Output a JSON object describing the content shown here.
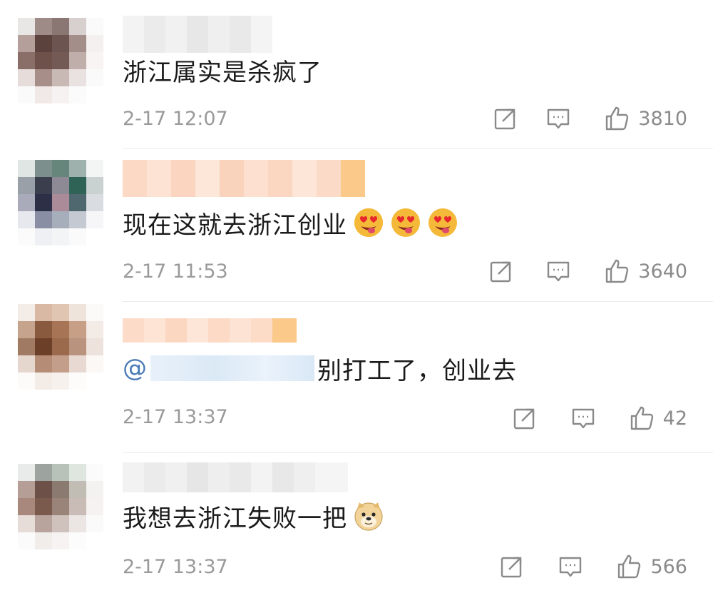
{
  "comments": [
    {
      "text": "浙江属实是杀疯了",
      "time": "2-17 12:07",
      "likes": "3810",
      "emojis": []
    },
    {
      "text": "现在这就去浙江创业",
      "time": "2-17 11:53",
      "likes": "3640",
      "emojis": [
        "heart-eyes-emoji",
        "heart-eyes-emoji",
        "heart-eyes-emoji"
      ]
    },
    {
      "mention": "@",
      "text": "别打工了，创业去",
      "time": "2-17 13:37",
      "likes": "42",
      "emojis": []
    },
    {
      "text": "我想去浙江失败一把",
      "time": "2-17 13:37",
      "likes": "566",
      "emojis": [
        "doge-emoji"
      ]
    }
  ],
  "icons": {
    "share": "share-icon",
    "comment": "comment-icon",
    "like": "like-icon"
  },
  "colors": {
    "text": "#1a1a1a",
    "meta": "#9a9a9a",
    "mention": "#4a7bb7"
  }
}
